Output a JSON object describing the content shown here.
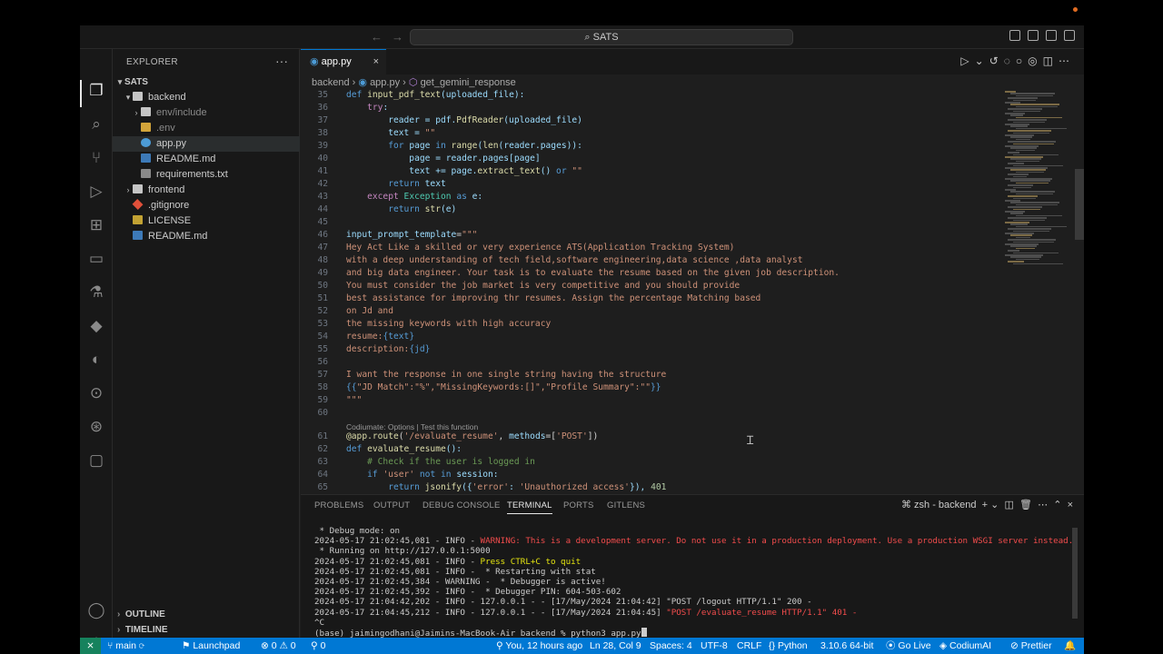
{
  "window": {
    "command_center": "SATS"
  },
  "sidebar": {
    "title": "EXPLORER",
    "more": "···",
    "root": "SATS",
    "items": [
      {
        "label": "backend",
        "kind": "folder",
        "depth": 1,
        "open": true
      },
      {
        "label": "env/include",
        "kind": "folder",
        "depth": 2,
        "dim": true
      },
      {
        "label": ".env",
        "kind": "env",
        "depth": 2,
        "dim": true
      },
      {
        "label": "app.py",
        "kind": "py",
        "depth": 2,
        "selected": true
      },
      {
        "label": "README.md",
        "kind": "md",
        "depth": 2
      },
      {
        "label": "requirements.txt",
        "kind": "txt",
        "depth": 2
      },
      {
        "label": "frontend",
        "kind": "folder",
        "depth": 1
      },
      {
        "label": ".gitignore",
        "kind": "git",
        "depth": 1
      },
      {
        "label": "LICENSE",
        "kind": "lic",
        "depth": 1
      },
      {
        "label": "README.md",
        "kind": "md",
        "depth": 1
      }
    ],
    "outline": "OUTLINE",
    "timeline": "TIMELINE"
  },
  "editor": {
    "tab": "app.py",
    "breadcrumb": [
      "backend",
      "app.py",
      "get_gemini_response"
    ],
    "codelens": "Codiumate: Options | Test this function",
    "lines": [
      {
        "n": "35",
        "code": "def input_pdf_text(uploaded_file):"
      },
      {
        "n": "36",
        "code": "    try:"
      },
      {
        "n": "37",
        "code": "        reader = pdf.PdfReader(uploaded_file)"
      },
      {
        "n": "38",
        "code": "        text = \"\""
      },
      {
        "n": "39",
        "code": "        for page in range(len(reader.pages)):"
      },
      {
        "n": "40",
        "code": "            page = reader.pages[page]"
      },
      {
        "n": "41",
        "code": "            text += page.extract_text() or \"\""
      },
      {
        "n": "42",
        "code": "        return text"
      },
      {
        "n": "43",
        "code": "    except Exception as e:"
      },
      {
        "n": "44",
        "code": "        return str(e)"
      },
      {
        "n": "45",
        "code": ""
      },
      {
        "n": "46",
        "code": "input_prompt_template=\"\"\""
      },
      {
        "n": "47",
        "code": "Hey Act Like a skilled or very experience ATS(Application Tracking System)"
      },
      {
        "n": "48",
        "code": "with a deep understanding of tech field,software engineering,data science ,data analyst"
      },
      {
        "n": "49",
        "code": "and big data engineer. Your task is to evaluate the resume based on the given job description."
      },
      {
        "n": "50",
        "code": "You must consider the job market is very competitive and you should provide"
      },
      {
        "n": "51",
        "code": "best assistance for improving thr resumes. Assign the percentage Matching based"
      },
      {
        "n": "52",
        "code": "on Jd and"
      },
      {
        "n": "53",
        "code": "the missing keywords with high accuracy"
      },
      {
        "n": "54",
        "code": "resume:{text}"
      },
      {
        "n": "55",
        "code": "description:{jd}"
      },
      {
        "n": "56",
        "code": ""
      },
      {
        "n": "57",
        "code": "I want the response in one single string having the structure"
      },
      {
        "n": "58",
        "code": "{{\"JD Match\":\"%\",\"MissingKeywords:[]\",\"Profile Summary\":\"\"}}"
      },
      {
        "n": "59",
        "code": "\"\"\""
      },
      {
        "n": "60",
        "code": ""
      },
      {
        "n": "61",
        "code": "@app.route('/evaluate_resume', methods=['POST'])"
      },
      {
        "n": "62",
        "code": "def evaluate_resume():"
      },
      {
        "n": "63",
        "code": "    # Check if the user is logged in"
      },
      {
        "n": "64",
        "code": "    if 'user' not in session:"
      },
      {
        "n": "65",
        "code": "        return jsonify({'error': 'Unauthorized access'}), 401"
      }
    ]
  },
  "panel": {
    "tabs": [
      "PROBLEMS",
      "OUTPUT",
      "DEBUG CONSOLE",
      "TERMINAL",
      "PORTS",
      "GITLENS"
    ],
    "active_tab": "TERMINAL",
    "terminal_name": "zsh - backend",
    "terminal": [
      {
        "plain": " * Debug mode: on"
      },
      {
        "plain": "2024-05-17 21:02:45,081 - INFO - ",
        "red": "WARNING: This is a development server. Do not use it in a production deployment. Use a production WSGI server instead."
      },
      {
        "plain": " * Running on http://127.0.0.1:5000"
      },
      {
        "plain": "2024-05-17 21:02:45,081 - INFO - ",
        "yellow": "Press CTRL+C to quit"
      },
      {
        "plain": "2024-05-17 21:02:45,081 - INFO -  * Restarting with stat"
      },
      {
        "plain": "2024-05-17 21:02:45,384 - WARNING -  * Debugger is active!"
      },
      {
        "plain": "2024-05-17 21:02:45,392 - INFO -  * Debugger PIN: 604-503-602"
      },
      {
        "plain": "2024-05-17 21:04:42,202 - INFO - 127.0.0.1 - - [17/May/2024 21:04:42] \"POST /logout HTTP/1.1\" 200 -"
      },
      {
        "plain": "2024-05-17 21:04:45,212 - INFO - 127.0.0.1 - - [17/May/2024 21:04:45] ",
        "red": "\"POST /evaluate_resume HTTP/1.1\" 401 -"
      },
      {
        "plain": "^C"
      },
      {
        "plain": "(base) jaimingodhani@Jaimins-MacBook-Air backend % python3 app.py"
      }
    ]
  },
  "statusbar": {
    "branch": "main",
    "launchpad": "Launchpad",
    "problems": "⊗ 0 ⚠ 0",
    "ports": "⚲ 0",
    "blame": "You, 12 hours ago",
    "position": "Ln 28, Col 9",
    "spaces": "Spaces: 4",
    "encoding": "UTF-8",
    "eol": "CRLF",
    "language": "Python",
    "interpreter": "3.10.6 64-bit",
    "golive": "Go Live",
    "codium": "CodiumAI",
    "prettier": "Prettier"
  }
}
